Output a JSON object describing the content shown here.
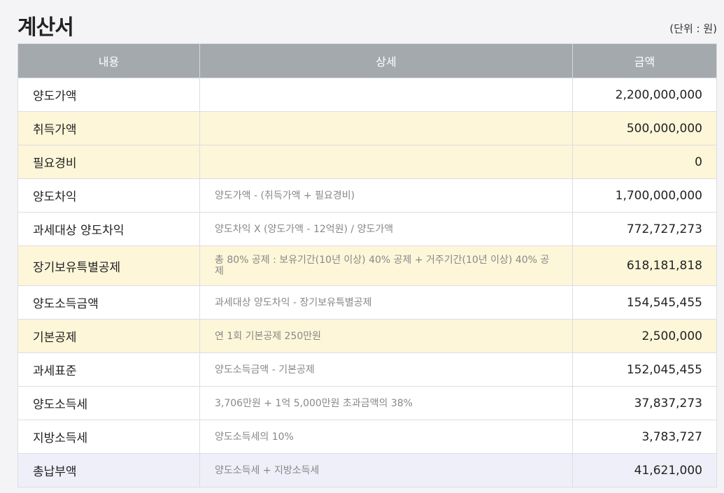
{
  "page": {
    "title": "계산서",
    "unit": "(단위 : 원)"
  },
  "table": {
    "headers": [
      "내용",
      "상세",
      "금액"
    ],
    "rows": [
      {
        "label": "양도가액",
        "detail": "",
        "amount": "2,200,000,000",
        "style": "white"
      },
      {
        "label": "취득가액",
        "detail": "",
        "amount": "500,000,000",
        "style": "yellow"
      },
      {
        "label": "필요경비",
        "detail": "",
        "amount": "0",
        "style": "yellow"
      },
      {
        "label": "양도차익",
        "detail": "양도가액 - (취득가액 + 필요경비)",
        "amount": "1,700,000,000",
        "style": "white"
      },
      {
        "label": "과세대상 양도차익",
        "detail": "양도차익 X (양도가액 - 12억원) / 양도가액",
        "amount": "772,727,273",
        "style": "white"
      },
      {
        "label": "장기보유특별공제",
        "detail": "총 80% 공제 : 보유기간(10년 이상) 40% 공제 + 거주기간(10년 이상) 40% 공제",
        "amount": "618,181,818",
        "style": "yellow"
      },
      {
        "label": "양도소득금액",
        "detail": "과세대상 양도차익 - 장기보유특별공제",
        "amount": "154,545,455",
        "style": "white"
      },
      {
        "label": "기본공제",
        "detail": "연 1회 기본공제 250만원",
        "amount": "2,500,000",
        "style": "yellow"
      },
      {
        "label": "과세표준",
        "detail": "양도소득금액 - 기본공제",
        "amount": "152,045,455",
        "style": "white"
      },
      {
        "label": "양도소득세",
        "detail": "3,706만원 + 1억 5,000만원 초과금액의 38%",
        "amount": "37,837,273",
        "style": "white"
      },
      {
        "label": "지방소득세",
        "detail": "양도소득세의 10%",
        "amount": "3,783,727",
        "style": "white"
      },
      {
        "label": "총납부액",
        "detail": "양도소득세 + 지방소득세",
        "amount": "41,621,000",
        "style": "total"
      }
    ]
  }
}
